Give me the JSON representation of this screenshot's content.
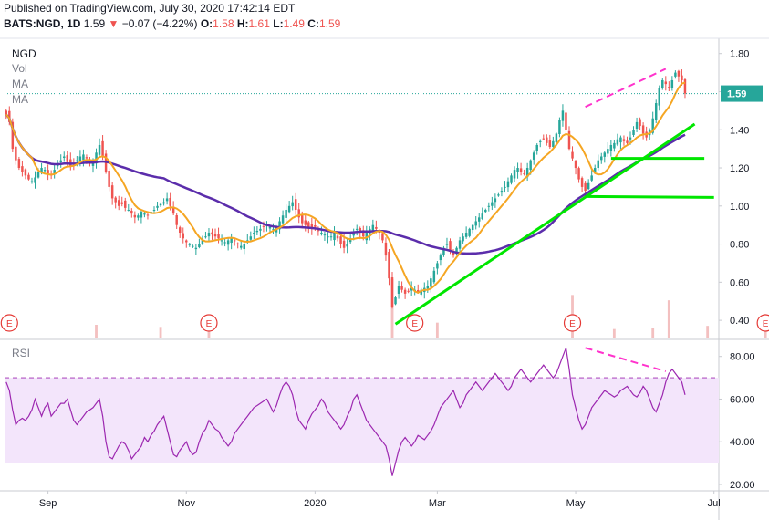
{
  "header": {
    "published": "Published on TradingView.com, July 30, 2020 17:42:14 EDT",
    "symbol": "BATS:NGD, 1D",
    "last": "1.59",
    "change_arrow": "▼",
    "change": "−0.07 (−4.22%)",
    "o_label": "O:",
    "o_value": "1.58",
    "h_label": "H:",
    "h_value": "1.61",
    "l_label": "L:",
    "l_value": "1.49",
    "c_label": "C:",
    "c_value": "1.59"
  },
  "legend": {
    "symbol": "NGD",
    "vol": "Vol",
    "ma1": "MA",
    "ma2": "MA",
    "rsi": "RSI"
  },
  "colors": {
    "up": "#26a69a",
    "down": "#ef5350",
    "ma_fast": "#f5a623",
    "ma_slow": "#5b2dab",
    "trend": "#00e600",
    "divergence": "#ff33cc",
    "rsi_line": "#9c27b0",
    "rsi_band": "#f3e5fb",
    "earnings": "#e53935",
    "price_line": "#26a69a"
  },
  "chart_data": [
    {
      "type": "candlestick",
      "title": "NGD",
      "last_price_label": "1.59",
      "y_ticks": [
        "1.80",
        "1.60",
        "1.40",
        "1.20",
        "1.00",
        "0.80",
        "0.60",
        "0.40"
      ],
      "ylim": [
        0.3,
        1.88
      ],
      "x_tick_labels": [
        "Sep",
        "Nov",
        "2020",
        "Mar",
        "May",
        "Jul"
      ],
      "x_tick_index": [
        13,
        56,
        96,
        134,
        177,
        220
      ],
      "earnings_markers": [
        "E",
        "E",
        "E",
        "E",
        "E"
      ],
      "earnings_index": [
        1,
        63,
        127,
        176,
        236
      ],
      "close": [
        1.48,
        1.44,
        1.3,
        1.24,
        1.2,
        1.18,
        1.16,
        1.14,
        1.13,
        1.15,
        1.18,
        1.2,
        1.19,
        1.17,
        1.16,
        1.19,
        1.22,
        1.24,
        1.26,
        1.23,
        1.21,
        1.22,
        1.24,
        1.26,
        1.27,
        1.25,
        1.23,
        1.24,
        1.28,
        1.32,
        1.26,
        1.18,
        1.1,
        1.04,
        1.02,
        1.0,
        1.01,
        0.99,
        0.98,
        0.96,
        0.94,
        0.95,
        0.97,
        0.96,
        0.95,
        0.97,
        0.98,
        1.0,
        1.01,
        1.02,
        1.04,
        1.0,
        0.96,
        0.9,
        0.86,
        0.83,
        0.81,
        0.8,
        0.79,
        0.78,
        0.8,
        0.82,
        0.84,
        0.86,
        0.85,
        0.84,
        0.83,
        0.82,
        0.81,
        0.82,
        0.83,
        0.82,
        0.8,
        0.79,
        0.8,
        0.82,
        0.84,
        0.86,
        0.87,
        0.88,
        0.89,
        0.9,
        0.89,
        0.88,
        0.89,
        0.92,
        0.95,
        0.98,
        1.0,
        1.02,
        0.98,
        0.94,
        0.91,
        0.9,
        0.89,
        0.88,
        0.89,
        0.87,
        0.86,
        0.85,
        0.84,
        0.84,
        0.86,
        0.83,
        0.8,
        0.78,
        0.8,
        0.83,
        0.86,
        0.88,
        0.86,
        0.84,
        0.86,
        0.88,
        0.9,
        0.88,
        0.86,
        0.82,
        0.74,
        0.62,
        0.47,
        0.52,
        0.58,
        0.56,
        0.54,
        0.55,
        0.57,
        0.56,
        0.55,
        0.56,
        0.57,
        0.58,
        0.62,
        0.66,
        0.7,
        0.74,
        0.78,
        0.8,
        0.76,
        0.74,
        0.78,
        0.82,
        0.84,
        0.86,
        0.88,
        0.9,
        0.92,
        0.94,
        0.96,
        0.98,
        1.0,
        1.02,
        1.04,
        1.06,
        1.08,
        1.1,
        1.13,
        1.16,
        1.19,
        1.2,
        1.18,
        1.17,
        1.2,
        1.24,
        1.28,
        1.32,
        1.34,
        1.35,
        1.33,
        1.31,
        1.34,
        1.38,
        1.45,
        1.5,
        1.4,
        1.3,
        1.25,
        1.2,
        1.14,
        1.1,
        1.08,
        1.12,
        1.16,
        1.2,
        1.24,
        1.26,
        1.28,
        1.3,
        1.32,
        1.33,
        1.35,
        1.36,
        1.34,
        1.33,
        1.36,
        1.4,
        1.44,
        1.42,
        1.38,
        1.36,
        1.4,
        1.46,
        1.54,
        1.62,
        1.66,
        1.64,
        1.62,
        1.66,
        1.7,
        1.68,
        1.66,
        1.59
      ],
      "volume_days": [
        28,
        48,
        63,
        120,
        134,
        176,
        189,
        201,
        206,
        218,
        236
      ],
      "volume_values": [
        12,
        10,
        9,
        55,
        14,
        40,
        8,
        9,
        35,
        11,
        22
      ],
      "ma_fast": {
        "period": 9
      },
      "ma_slow": {
        "period": 50
      },
      "annotations": {
        "uptrend": [
          [
            0.38,
            1.43
          ]
        ],
        "support_levels": [
          1.25,
          1.05
        ],
        "divergence_price": [
          1.52,
          1.72
        ]
      }
    },
    {
      "type": "line",
      "title": "RSI",
      "y_ticks": [
        "80.00",
        "60.00",
        "40.00",
        "20.00"
      ],
      "ylim": [
        17,
        88
      ],
      "band": [
        30,
        70
      ],
      "divergence_rsi": [
        84,
        73
      ],
      "values": [
        68,
        64,
        55,
        48,
        50,
        51,
        50,
        52,
        55,
        60,
        56,
        52,
        56,
        58,
        52,
        54,
        56,
        58,
        58,
        60,
        55,
        50,
        48,
        50,
        52,
        54,
        55,
        56,
        58,
        60,
        52,
        40,
        33,
        32,
        35,
        38,
        40,
        39,
        36,
        32,
        34,
        36,
        38,
        42,
        40,
        43,
        45,
        48,
        50,
        52,
        46,
        40,
        34,
        33,
        36,
        38,
        40,
        36,
        34,
        35,
        40,
        44,
        46,
        50,
        48,
        46,
        45,
        42,
        40,
        38,
        40,
        44,
        46,
        48,
        50,
        52,
        54,
        56,
        57,
        58,
        59,
        60,
        57,
        54,
        57,
        62,
        66,
        68,
        66,
        62,
        55,
        50,
        48,
        46,
        50,
        53,
        55,
        57,
        60,
        58,
        54,
        52,
        50,
        48,
        46,
        48,
        52,
        55,
        60,
        62,
        58,
        54,
        50,
        48,
        46,
        44,
        42,
        40,
        38,
        32,
        24,
        30,
        36,
        40,
        42,
        40,
        38,
        40,
        43,
        42,
        41,
        43,
        45,
        48,
        52,
        56,
        58,
        60,
        62,
        64,
        60,
        56,
        58,
        62,
        64,
        66,
        68,
        66,
        64,
        66,
        68,
        70,
        72,
        70,
        68,
        66,
        64,
        66,
        70,
        72,
        74,
        72,
        70,
        68,
        70,
        72,
        74,
        76,
        74,
        72,
        70,
        72,
        76,
        80,
        84,
        74,
        62,
        56,
        50,
        46,
        48,
        52,
        56,
        58,
        60,
        62,
        64,
        63,
        62,
        61,
        62,
        64,
        65,
        66,
        64,
        62,
        61,
        63,
        66,
        64,
        60,
        56,
        54,
        58,
        62,
        68,
        72,
        74,
        72,
        70,
        68,
        62
      ]
    }
  ]
}
